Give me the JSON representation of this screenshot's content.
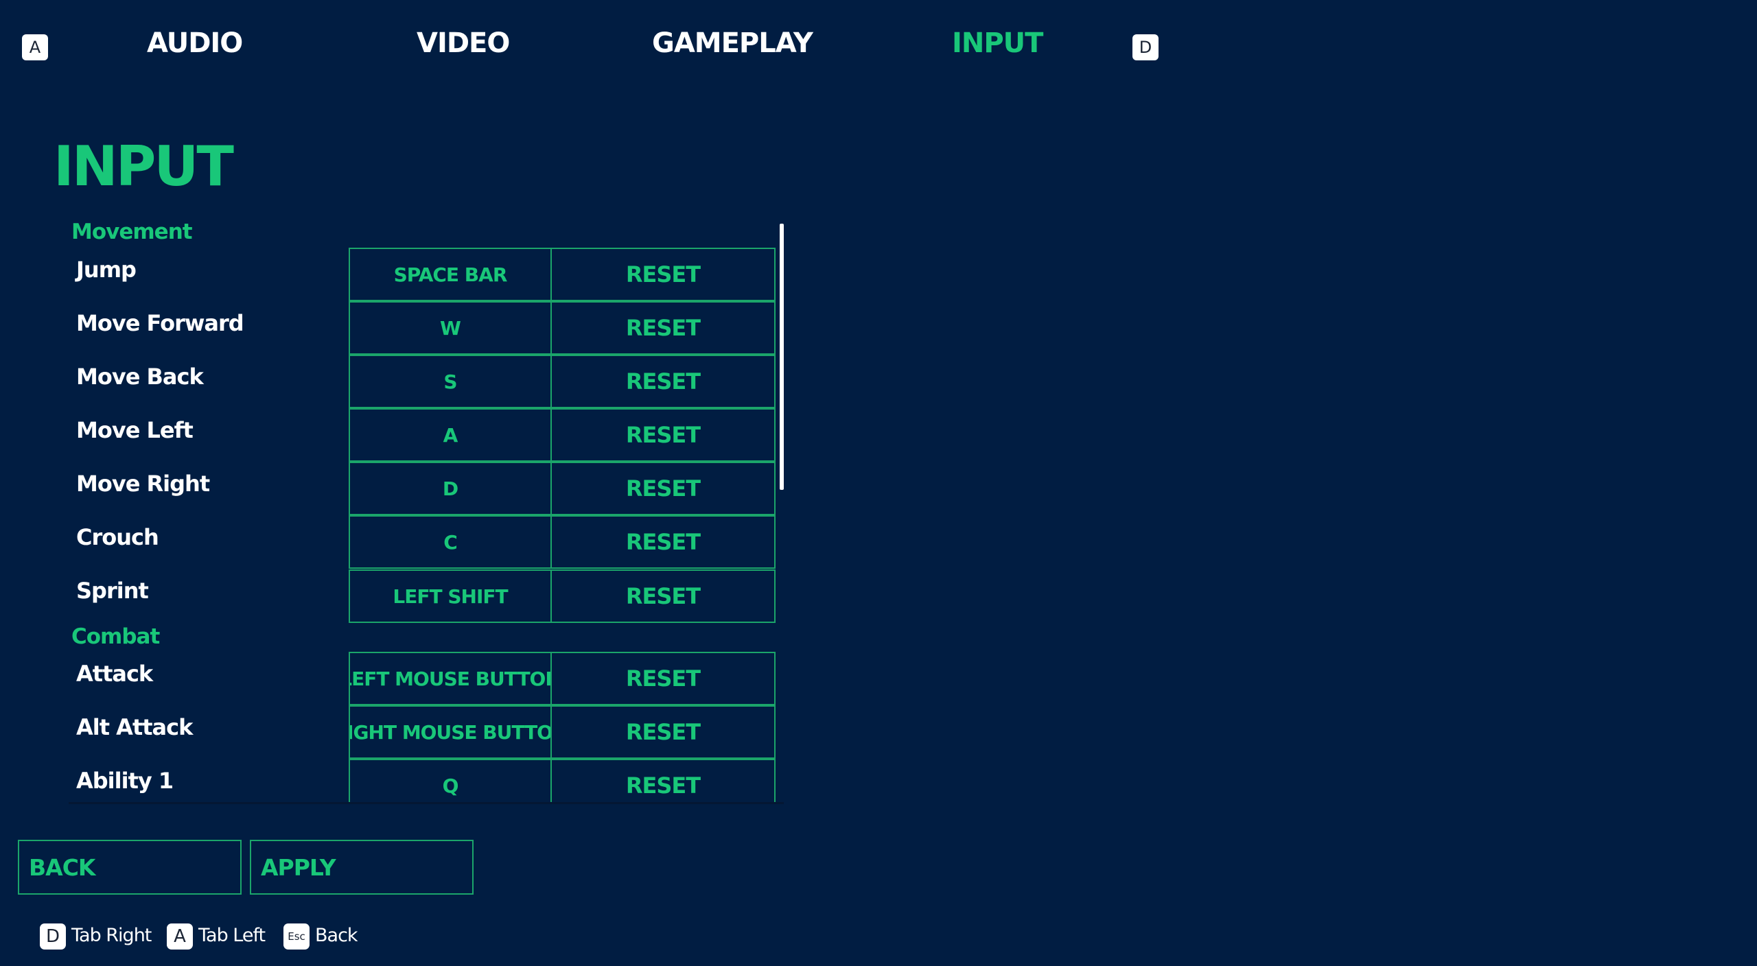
{
  "tabs": {
    "left_key": "A",
    "right_key": "D",
    "items": [
      {
        "label": "AUDIO"
      },
      {
        "label": "VIDEO"
      },
      {
        "label": "GAMEPLAY"
      },
      {
        "label": "INPUT",
        "active": true
      }
    ]
  },
  "page_title": "INPUT",
  "sections": [
    {
      "title": "Movement",
      "rows": [
        {
          "label": "Jump",
          "binding": "SPACE BAR",
          "reset": "RESET"
        },
        {
          "label": "Move Forward",
          "binding": "W",
          "reset": "RESET"
        },
        {
          "label": "Move Back",
          "binding": "S",
          "reset": "RESET"
        },
        {
          "label": "Move Left",
          "binding": "A",
          "reset": "RESET"
        },
        {
          "label": "Move Right",
          "binding": "D",
          "reset": "RESET"
        },
        {
          "label": "Crouch",
          "binding": "C",
          "reset": "RESET"
        },
        {
          "label": "Sprint",
          "binding": "LEFT SHIFT",
          "reset": "RESET"
        }
      ]
    },
    {
      "title": "Combat",
      "rows": [
        {
          "label": "Attack",
          "binding": "LEFT MOUSE BUTTON",
          "reset": "RESET"
        },
        {
          "label": "Alt Attack",
          "binding": "RIGHT MOUSE BUTTON",
          "reset": "RESET"
        },
        {
          "label": "Ability 1",
          "binding": "Q",
          "reset": "RESET"
        }
      ]
    }
  ],
  "footer": {
    "back_label": "BACK",
    "apply_label": "APPLY"
  },
  "hints": [
    {
      "key": "D",
      "label": "Tab Right"
    },
    {
      "key": "A",
      "label": "Tab Left"
    },
    {
      "key": "Esc",
      "label": "Back"
    }
  ],
  "colors": {
    "background": "#011d42",
    "accent": "#19c779",
    "border": "#1ba56a",
    "text": "#ffffff"
  }
}
